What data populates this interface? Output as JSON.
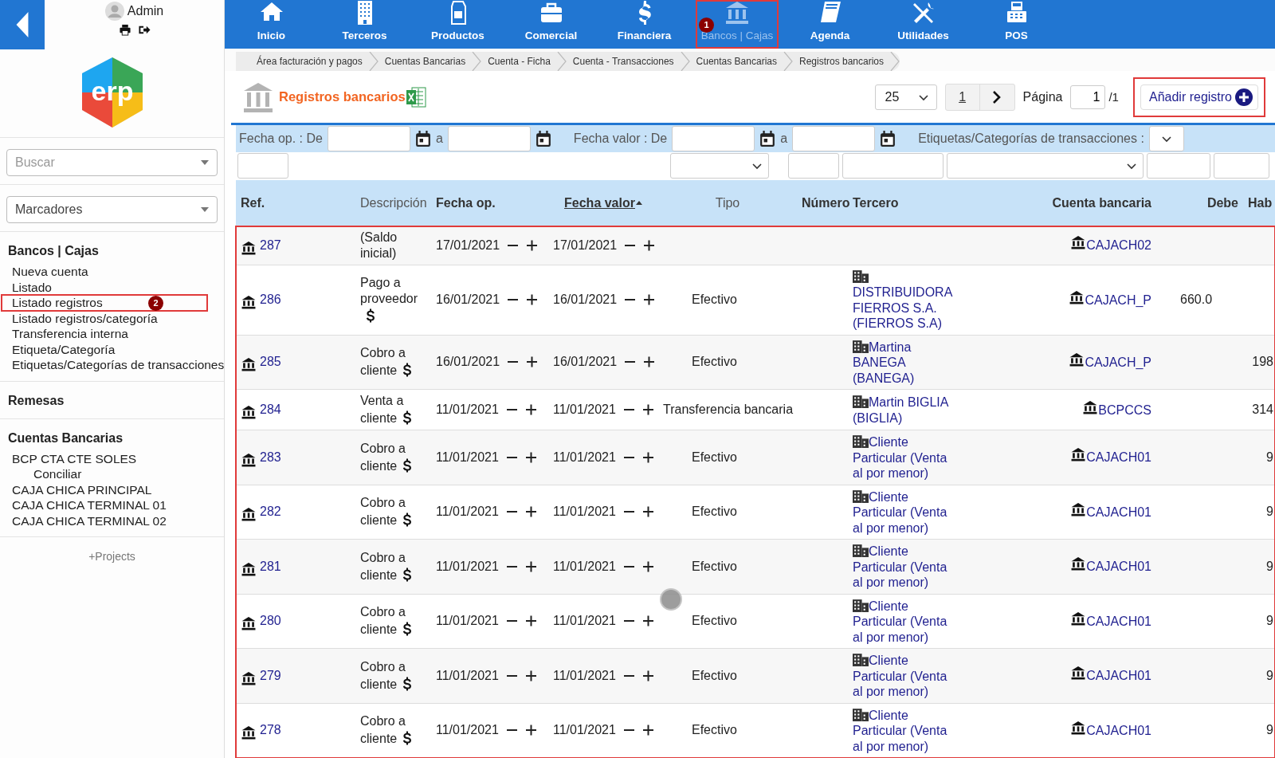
{
  "sidebar": {
    "user": "Admin",
    "logo_text": "erp",
    "search_placeholder": "Buscar",
    "bookmarks_placeholder": "Marcadores",
    "sections": [
      {
        "title": "Bancos | Cajas",
        "items": [
          {
            "label": "Nueva cuenta",
            "selected": false
          },
          {
            "label": "Listado",
            "selected": false
          },
          {
            "label": "Listado registros",
            "selected": true,
            "annotation": "2"
          },
          {
            "label": "Listado registros/categoría",
            "selected": false
          },
          {
            "label": "Transferencia interna",
            "selected": false
          },
          {
            "label": "Etiqueta/Categoría",
            "selected": false
          },
          {
            "label": "Etiquetas/Categorías de transacciones",
            "selected": false
          }
        ]
      },
      {
        "title": "Remesas"
      },
      {
        "title": "Cuentas Bancarias",
        "items": [
          {
            "label": "BCP CTA CTE SOLES",
            "selected": false,
            "children": [
              {
                "label": "Conciliar",
                "selected": false
              }
            ]
          },
          {
            "label": "CAJA CHICA PRINCIPAL",
            "selected": false
          },
          {
            "label": "CAJA CHICA TERMINAL 01",
            "selected": false
          },
          {
            "label": "CAJA CHICA TERMINAL 02",
            "selected": false
          }
        ]
      }
    ],
    "projects": "+Projects"
  },
  "topnav": [
    {
      "label": "Inicio",
      "selected": false
    },
    {
      "label": "Terceros",
      "selected": false
    },
    {
      "label": "Productos",
      "selected": false
    },
    {
      "label": "Comercial",
      "selected": false
    },
    {
      "label": "Financiera",
      "selected": false
    },
    {
      "label": "Bancos | Cajas",
      "selected": true,
      "annotation": "1"
    },
    {
      "label": "Agenda",
      "selected": false
    },
    {
      "label": "Utilidades",
      "selected": false
    },
    {
      "label": "POS",
      "selected": false
    }
  ],
  "breadcrumb": [
    "Área facturación y pagos",
    "Cuentas Bancarias",
    "Cuenta - Ficha",
    "Cuenta - Transacciones",
    "Cuentas Bancarias",
    "Registros bancarios"
  ],
  "page_title": "Registros bancarios",
  "pagination": {
    "page_size": "25",
    "page_link": "1",
    "page_label": "Página",
    "page_value": "1",
    "page_total": "/1"
  },
  "add_button": {
    "label": "Añadir registro",
    "annotated": true
  },
  "filters": {
    "op_label": "Fecha op. : De",
    "to_label": "a",
    "value_label": "Fecha valor : De",
    "value_to_label": "a",
    "tags_label": "Etiquetas/Categorías de transacciones :"
  },
  "column_filters": [
    {
      "kind": "input"
    },
    {
      "kind": "select"
    },
    {
      "kind": "input"
    },
    {
      "kind": "input"
    },
    {
      "kind": "select"
    },
    {
      "kind": "input"
    },
    {
      "kind": "input"
    }
  ],
  "table": {
    "annotated": true,
    "columns": [
      {
        "label": "Ref.",
        "sortable": true,
        "sorted": false
      },
      {
        "label": "Descripción",
        "sortable": false,
        "sorted": false
      },
      {
        "label": "Fecha op.",
        "sortable": true,
        "sorted": false
      },
      {
        "label": "Fecha valor",
        "sortable": true,
        "sorted": true
      },
      {
        "label": "Tipo",
        "sortable": false,
        "sorted": false
      },
      {
        "label": "Número",
        "sortable": true,
        "sorted": false
      },
      {
        "label": "Tercero",
        "sortable": true,
        "sorted": false
      },
      {
        "label": "Cuenta bancaria",
        "sortable": true,
        "sorted": false
      },
      {
        "label": "Debe",
        "sortable": true,
        "sorted": false
      },
      {
        "label": "Hab",
        "sortable": true,
        "sorted": false
      }
    ],
    "rows": [
      {
        "ref": "287",
        "kind": "opening",
        "description": "(Saldo inicial)",
        "date_op": "17/01/2021",
        "date_value": "17/01/2021",
        "account": "CAJACH02"
      },
      {
        "ref": "286",
        "kind": "payment",
        "description": "Pago a proveedor",
        "date_op": "16/01/2021",
        "date_value": "16/01/2021",
        "type": "Efectivo",
        "third_party": "DISTRIBUIDORA FIERROS S.A. (FIERROS S.A)",
        "account": "CAJACH_P",
        "debit": "660.0"
      },
      {
        "ref": "285",
        "kind": "payment",
        "description": "Cobro a cliente",
        "date_op": "16/01/2021",
        "date_value": "16/01/2021",
        "type": "Efectivo",
        "third_party": "Martina BANEGA (BANEGA)",
        "account": "CAJACH_P",
        "credit": "198"
      },
      {
        "ref": "284",
        "kind": "payment",
        "description": "Venta a cliente",
        "date_op": "11/01/2021",
        "date_value": "11/01/2021",
        "type": "Transferencia bancaria",
        "third_party": "Martin BIGLIA (BIGLIA)",
        "account": "BCPCCS",
        "credit": "314"
      },
      {
        "ref": "283",
        "kind": "payment",
        "description": "Cobro a cliente",
        "date_op": "11/01/2021",
        "date_value": "11/01/2021",
        "type": "Efectivo",
        "third_party": "Cliente Particular (Venta al por menor)",
        "account": "CAJACH01",
        "credit": "9"
      },
      {
        "ref": "282",
        "kind": "payment",
        "description": "Cobro a cliente",
        "date_op": "11/01/2021",
        "date_value": "11/01/2021",
        "type": "Efectivo",
        "third_party": "Cliente Particular (Venta al por menor)",
        "account": "CAJACH01",
        "credit": "9"
      },
      {
        "ref": "281",
        "kind": "payment",
        "description": "Cobro a cliente",
        "date_op": "11/01/2021",
        "date_value": "11/01/2021",
        "type": "Efectivo",
        "third_party": "Cliente Particular (Venta al por menor)",
        "account": "CAJACH01",
        "credit": "9"
      },
      {
        "ref": "280",
        "kind": "payment",
        "description": "Cobro a cliente",
        "date_op": "11/01/2021",
        "date_value": "11/01/2021",
        "type": "Efectivo",
        "third_party": "Cliente Particular (Venta al por menor)",
        "account": "CAJACH01",
        "credit": "9"
      },
      {
        "ref": "279",
        "kind": "payment",
        "description": "Cobro a cliente",
        "date_op": "11/01/2021",
        "date_value": "11/01/2021",
        "type": "Efectivo",
        "third_party": "Cliente Particular (Venta al por menor)",
        "account": "CAJACH01",
        "credit": "9"
      },
      {
        "ref": "278",
        "kind": "payment",
        "description": "Cobro a cliente",
        "date_op": "11/01/2021",
        "date_value": "11/01/2021",
        "type": "Efectivo",
        "third_party": "Cliente Particular (Venta al por menor)",
        "account": "CAJACH01",
        "credit": "9"
      }
    ]
  }
}
